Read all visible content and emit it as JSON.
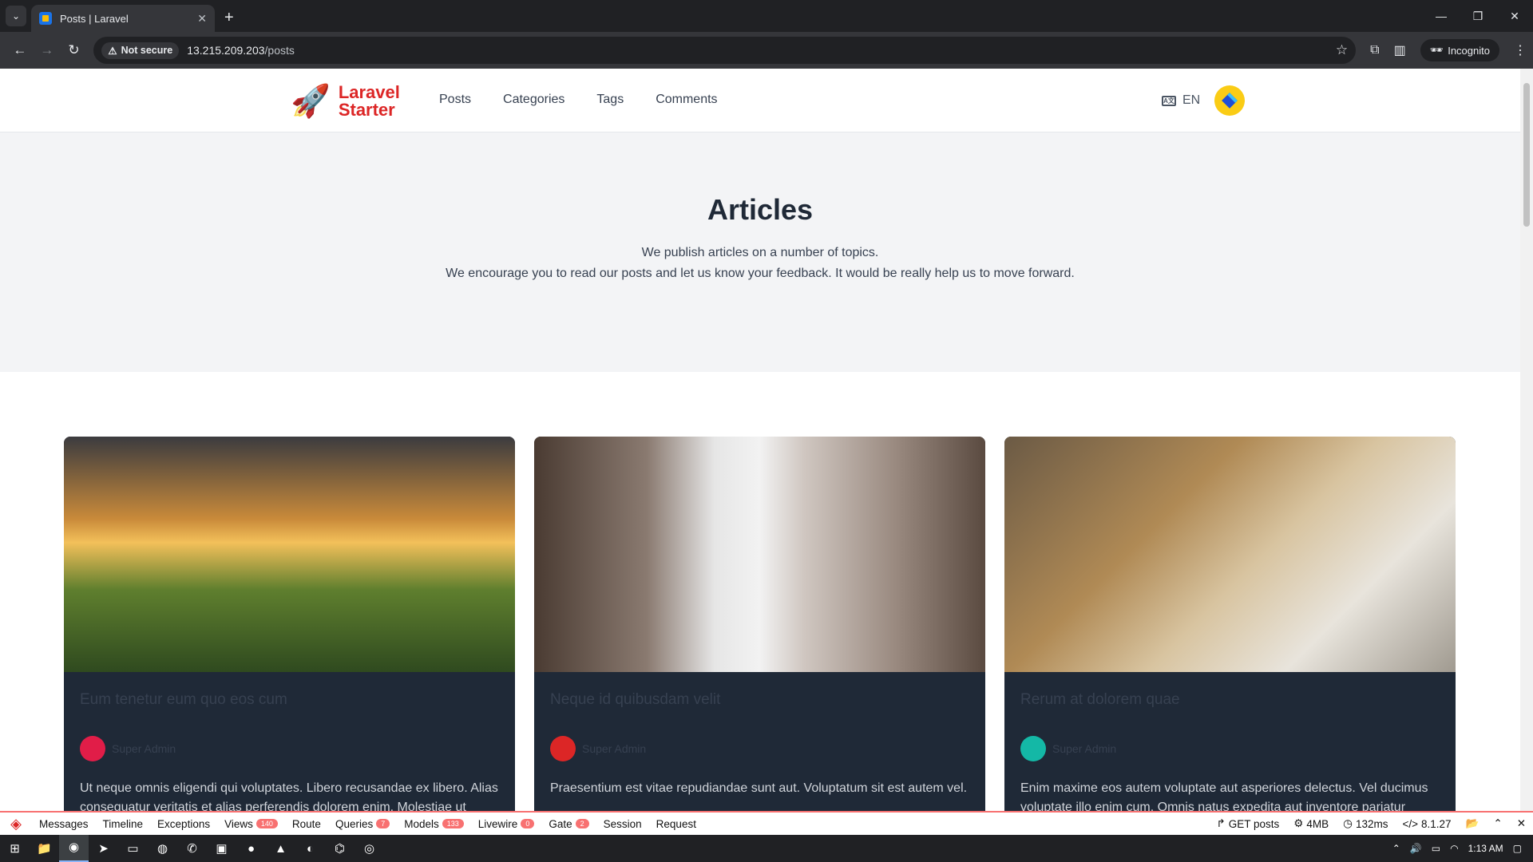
{
  "browser": {
    "tab_title": "Posts | Laravel",
    "not_secure": "Not secure",
    "url_host": "13.215.209.203",
    "url_path": "/posts",
    "incognito": "Incognito"
  },
  "site": {
    "logo_line1": "Laravel",
    "logo_line2": "Starter",
    "nav": [
      "Posts",
      "Categories",
      "Tags",
      "Comments"
    ],
    "lang": "EN",
    "lang_icon": "A文"
  },
  "hero": {
    "title": "Articles",
    "line1": "We publish articles on a number of topics.",
    "line2": "We encourage you to read our posts and let us know your feedback. It would be really help us to move forward."
  },
  "posts": [
    {
      "title": "Eum tenetur eum quo eos cum",
      "author": "Super Admin",
      "avatar_color": "#e11d48",
      "excerpt": "Ut neque omnis eligendi qui voluptates. Libero recusandae ex libero. Alias consequatur veritatis et alias perferendis dolorem enim. Molestiae ut"
    },
    {
      "title": "Neque id quibusdam velit",
      "author": "Super Admin",
      "avatar_color": "#dc2626",
      "excerpt": "Praesentium est vitae repudiandae sunt aut. Voluptatum sit est autem vel."
    },
    {
      "title": "Rerum at dolorem quae",
      "author": "Super Admin",
      "avatar_color": "#14b8a6",
      "excerpt": "Enim maxime eos autem voluptate aut asperiores delectus. Vel ducimus voluptate illo enim cum. Omnis natus expedita aut inventore pariatur"
    }
  ],
  "debugbar": {
    "items": [
      {
        "label": "Messages",
        "badge": ""
      },
      {
        "label": "Timeline",
        "badge": ""
      },
      {
        "label": "Exceptions",
        "badge": ""
      },
      {
        "label": "Views",
        "badge": "140"
      },
      {
        "label": "Route",
        "badge": ""
      },
      {
        "label": "Queries",
        "badge": "7"
      },
      {
        "label": "Models",
        "badge": "133"
      },
      {
        "label": "Livewire",
        "badge": "0"
      },
      {
        "label": "Gate",
        "badge": "2"
      },
      {
        "label": "Session",
        "badge": ""
      },
      {
        "label": "Request",
        "badge": ""
      }
    ],
    "method": "GET posts",
    "memory": "4MB",
    "time": "132ms",
    "php": "8.1.27"
  },
  "taskbar": {
    "clock": "1:13 AM"
  }
}
